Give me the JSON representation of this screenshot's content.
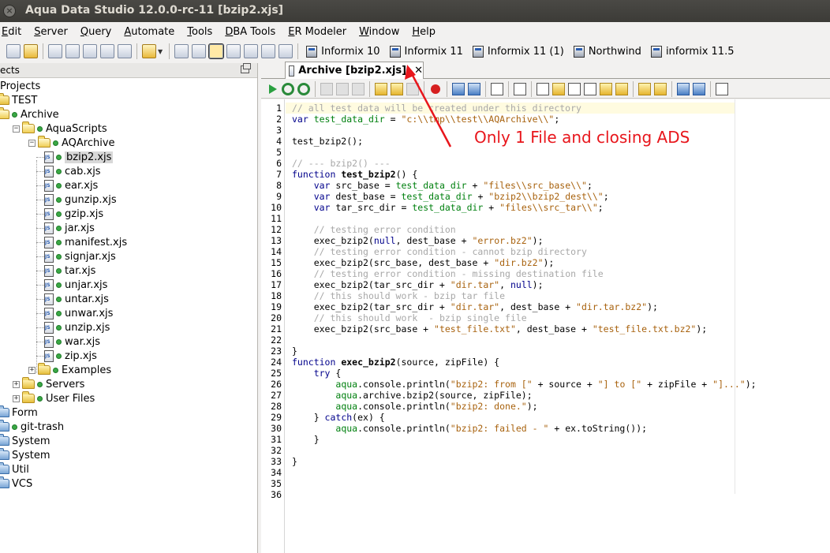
{
  "window": {
    "title": "Aqua Data Studio 12.0.0-rc-11 [bzip2.xjs]"
  },
  "menu": [
    {
      "mnemonic": "E",
      "rest": "dit"
    },
    {
      "mnemonic": "S",
      "rest": "erver"
    },
    {
      "mnemonic": "Q",
      "rest": "uery"
    },
    {
      "mnemonic": "A",
      "rest": "utomate"
    },
    {
      "mnemonic": "T",
      "rest": "ools"
    },
    {
      "mnemonic": "D",
      "rest": "BA Tools"
    },
    {
      "mnemonic": "E",
      "rest": "R Modeler"
    },
    {
      "mnemonic": "W",
      "rest": "indow"
    },
    {
      "mnemonic": "H",
      "rest": "elp"
    }
  ],
  "connections": [
    "Informix 10",
    "Informix 11",
    "Informix 11 (1)",
    "Northwind",
    "informix 11.5"
  ],
  "projects_panel": {
    "header": "ects",
    "tree": [
      {
        "label": "Projects",
        "indent": 0,
        "kind": "root"
      },
      {
        "label": "TEST",
        "indent": 0,
        "kind": "folder-yellow"
      },
      {
        "label": "Archive",
        "indent": 0,
        "kind": "folder-open-dot"
      },
      {
        "label": "AquaScripts",
        "indent": 1,
        "kind": "folder-toggle-open"
      },
      {
        "label": "AQArchive",
        "indent": 2,
        "kind": "folder-toggle-open"
      },
      {
        "label": "bzip2.xjs",
        "indent": 3,
        "kind": "file",
        "selected": true
      },
      {
        "label": "cab.xjs",
        "indent": 3,
        "kind": "file"
      },
      {
        "label": "ear.xjs",
        "indent": 3,
        "kind": "file"
      },
      {
        "label": "gunzip.xjs",
        "indent": 3,
        "kind": "file"
      },
      {
        "label": "gzip.xjs",
        "indent": 3,
        "kind": "file"
      },
      {
        "label": "jar.xjs",
        "indent": 3,
        "kind": "file"
      },
      {
        "label": "manifest.xjs",
        "indent": 3,
        "kind": "file"
      },
      {
        "label": "signjar.xjs",
        "indent": 3,
        "kind": "file"
      },
      {
        "label": "tar.xjs",
        "indent": 3,
        "kind": "file"
      },
      {
        "label": "unjar.xjs",
        "indent": 3,
        "kind": "file"
      },
      {
        "label": "untar.xjs",
        "indent": 3,
        "kind": "file"
      },
      {
        "label": "unwar.xjs",
        "indent": 3,
        "kind": "file"
      },
      {
        "label": "unzip.xjs",
        "indent": 3,
        "kind": "file"
      },
      {
        "label": "war.xjs",
        "indent": 3,
        "kind": "file"
      },
      {
        "label": "zip.xjs",
        "indent": 3,
        "kind": "file"
      },
      {
        "label": "Examples",
        "indent": 2,
        "kind": "folder-toggle-closed"
      },
      {
        "label": "Servers",
        "indent": 1,
        "kind": "folder-toggle-closed"
      },
      {
        "label": "User Files",
        "indent": 1,
        "kind": "folder-toggle-closed"
      },
      {
        "label": "Form",
        "indent": 0,
        "kind": "folder-blue"
      },
      {
        "label": "git-trash",
        "indent": 0,
        "kind": "folder-blue-dot"
      },
      {
        "label": "System",
        "indent": 0,
        "kind": "folder-blue"
      },
      {
        "label": "System",
        "indent": 0,
        "kind": "folder-blue"
      },
      {
        "label": "Util",
        "indent": 0,
        "kind": "folder-blue"
      },
      {
        "label": "VCS",
        "indent": 0,
        "kind": "folder-blue"
      }
    ]
  },
  "editor": {
    "tab_label": "Archive [bzip2.xjs]",
    "tab_close": "✕",
    "line_count": 36,
    "lines": [
      [
        [
          "c",
          "// all test data will be created under this directory"
        ]
      ],
      [
        [
          "k",
          "var "
        ],
        [
          "v",
          "test_data_dir"
        ],
        [
          "p",
          " = "
        ],
        [
          "s",
          "\"c:\\\\tmp\\\\test\\\\AQArchive\\\\\""
        ],
        [
          "p",
          ";"
        ]
      ],
      [],
      [
        [
          "p",
          "test_bzip2();"
        ]
      ],
      [],
      [
        [
          "c",
          "// --- bzip2() ---"
        ]
      ],
      [
        [
          "k",
          "function "
        ],
        [
          "f",
          "test_bzip2"
        ],
        [
          "p",
          "() {"
        ]
      ],
      [
        [
          "p",
          "    "
        ],
        [
          "k",
          "var "
        ],
        [
          "p",
          "src_base = "
        ],
        [
          "v",
          "test_data_dir"
        ],
        [
          "p",
          " + "
        ],
        [
          "s",
          "\"files\\\\src_base\\\\\""
        ],
        [
          "p",
          ";"
        ]
      ],
      [
        [
          "p",
          "    "
        ],
        [
          "k",
          "var "
        ],
        [
          "p",
          "dest_base = "
        ],
        [
          "v",
          "test_data_dir"
        ],
        [
          "p",
          " + "
        ],
        [
          "s",
          "\"bzip2\\\\bzip2_dest\\\\\""
        ],
        [
          "p",
          ";"
        ]
      ],
      [
        [
          "p",
          "    "
        ],
        [
          "k",
          "var "
        ],
        [
          "p",
          "tar_src_dir = "
        ],
        [
          "v",
          "test_data_dir"
        ],
        [
          "p",
          " + "
        ],
        [
          "s",
          "\"files\\\\src_tar\\\\\""
        ],
        [
          "p",
          ";"
        ]
      ],
      [],
      [
        [
          "p",
          "    "
        ],
        [
          "c",
          "// testing error condition"
        ]
      ],
      [
        [
          "p",
          "    exec_bzip2("
        ],
        [
          "k",
          "null"
        ],
        [
          "p",
          ", dest_base + "
        ],
        [
          "s",
          "\"error.bz2\""
        ],
        [
          "p",
          ");"
        ]
      ],
      [
        [
          "p",
          "    "
        ],
        [
          "c",
          "// testing error condition - cannot bzip directory"
        ]
      ],
      [
        [
          "p",
          "    exec_bzip2(src_base, dest_base + "
        ],
        [
          "s",
          "\"dir.bz2\""
        ],
        [
          "p",
          ");"
        ]
      ],
      [
        [
          "p",
          "    "
        ],
        [
          "c",
          "// testing error condition - missing destination file"
        ]
      ],
      [
        [
          "p",
          "    exec_bzip2(tar_src_dir + "
        ],
        [
          "s",
          "\"dir.tar\""
        ],
        [
          "p",
          ", "
        ],
        [
          "k",
          "null"
        ],
        [
          "p",
          ");"
        ]
      ],
      [
        [
          "p",
          "    "
        ],
        [
          "c",
          "// this should work - bzip tar file"
        ]
      ],
      [
        [
          "p",
          "    exec_bzip2(tar_src_dir + "
        ],
        [
          "s",
          "\"dir.tar\""
        ],
        [
          "p",
          ", dest_base + "
        ],
        [
          "s",
          "\"dir.tar.bz2\""
        ],
        [
          "p",
          ");"
        ]
      ],
      [
        [
          "p",
          "    "
        ],
        [
          "c",
          "// this should work  - bzip single file"
        ]
      ],
      [
        [
          "p",
          "    exec_bzip2(src_base + "
        ],
        [
          "s",
          "\"test_file.txt\""
        ],
        [
          "p",
          ", dest_base + "
        ],
        [
          "s",
          "\"test_file.txt.bz2\""
        ],
        [
          "p",
          ");"
        ]
      ],
      [],
      [
        [
          "p",
          "}"
        ]
      ],
      [
        [
          "k",
          "function "
        ],
        [
          "f",
          "exec_bzip2"
        ],
        [
          "p",
          "(source, zipFile) {"
        ]
      ],
      [
        [
          "p",
          "    "
        ],
        [
          "k",
          "try"
        ],
        [
          "p",
          " {"
        ]
      ],
      [
        [
          "p",
          "        "
        ],
        [
          "v",
          "aqua"
        ],
        [
          "p",
          ".console.println("
        ],
        [
          "s",
          "\"bzip2: from [\""
        ],
        [
          "p",
          " + source + "
        ],
        [
          "s",
          "\"] to [\""
        ],
        [
          "p",
          " + zipFile + "
        ],
        [
          "s",
          "\"]...\""
        ],
        [
          "p",
          ");"
        ]
      ],
      [
        [
          "p",
          "        "
        ],
        [
          "v",
          "aqua"
        ],
        [
          "p",
          ".archive.bzip2(source, zipFile);"
        ]
      ],
      [
        [
          "p",
          "        "
        ],
        [
          "v",
          "aqua"
        ],
        [
          "p",
          ".console.println("
        ],
        [
          "s",
          "\"bzip2: done.\""
        ],
        [
          "p",
          ");"
        ]
      ],
      [
        [
          "p",
          "    } "
        ],
        [
          "k",
          "catch"
        ],
        [
          "p",
          "(ex) {"
        ]
      ],
      [
        [
          "p",
          "        "
        ],
        [
          "v",
          "aqua"
        ],
        [
          "p",
          ".console.println("
        ],
        [
          "s",
          "\"bzip2: failed - \""
        ],
        [
          "p",
          " + ex.toString());"
        ]
      ],
      [
        [
          "p",
          "    }"
        ]
      ],
      [],
      [
        [
          "p",
          "}"
        ]
      ],
      [],
      [],
      []
    ]
  },
  "annotation": {
    "text": "Only 1 File and closing ADS",
    "color": "#e8161c"
  }
}
